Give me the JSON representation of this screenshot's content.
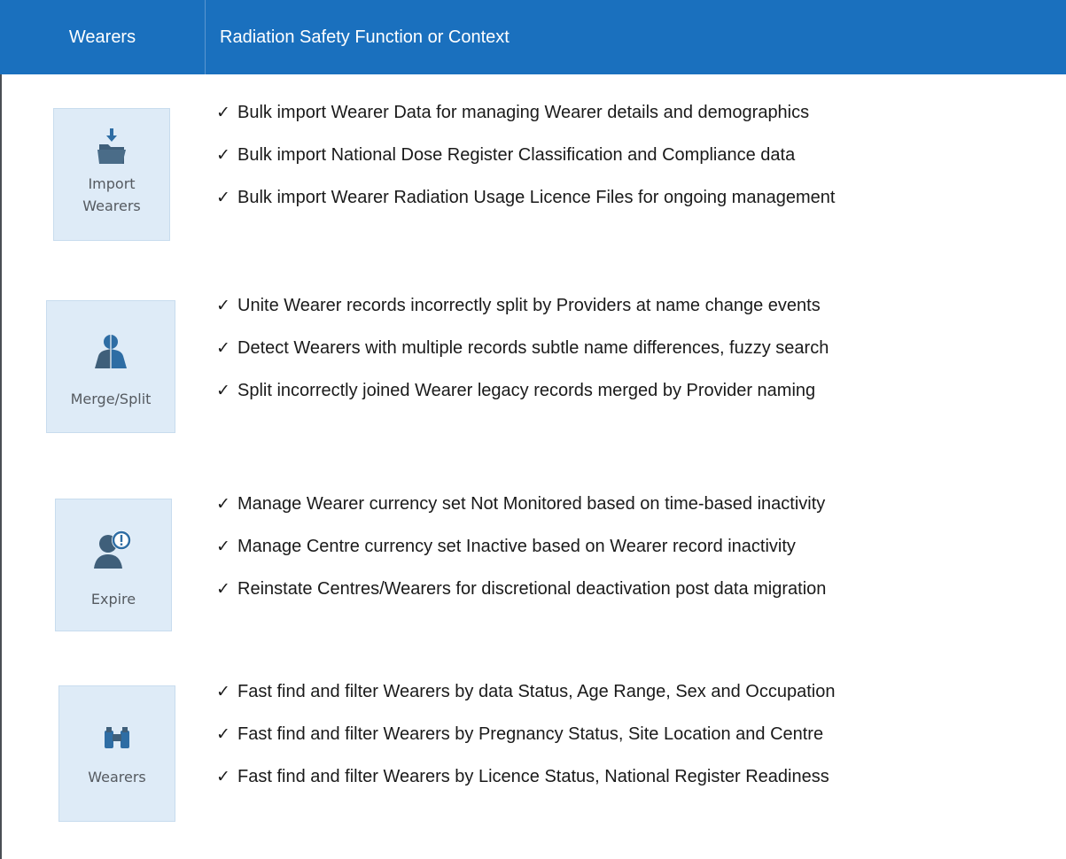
{
  "header": {
    "col1": "Wearers",
    "col2": "Radiation Safety Function or Context"
  },
  "check_glyph": "✓",
  "groups": [
    {
      "tile": {
        "label_line1": "Import",
        "label_line2": "Wearers",
        "icon": "folder-import-icon"
      },
      "items": [
        "Bulk import Wearer Data for managing Wearer details and demographics",
        "Bulk import National Dose Register Classification and Compliance data",
        "Bulk import Wearer Radiation Usage Licence Files for ongoing management"
      ]
    },
    {
      "tile": {
        "label": "Merge/Split",
        "icon": "merge-split-person-icon"
      },
      "items": [
        "Unite Wearer records incorrectly split by Providers at name change events",
        "Detect Wearers with multiple records subtle name differences, fuzzy search",
        "Split incorrectly joined Wearer legacy records merged by Provider naming"
      ]
    },
    {
      "tile": {
        "label": "Expire",
        "icon": "person-alert-icon"
      },
      "items": [
        "Manage Wearer currency set Not Monitored based on time-based inactivity",
        "Manage Centre currency set Inactive based on Wearer record inactivity",
        "Reinstate Centres/Wearers for discretional deactivation post data migration"
      ]
    },
    {
      "tile": {
        "label": "Wearers",
        "icon": "binoculars-icon"
      },
      "items": [
        "Fast find and filter Wearers by data Status, Age Range, Sex and Occupation",
        "Fast find and filter Wearers by Pregnancy Status, Site Location and Centre",
        "Fast find and filter Wearers by Licence Status, National Register Readiness"
      ]
    }
  ],
  "colors": {
    "header_bg": "#1a70be",
    "tile_bg": "#deebf7",
    "icon_blue": "#2e6da4",
    "icon_slate": "#3f5f7a"
  }
}
